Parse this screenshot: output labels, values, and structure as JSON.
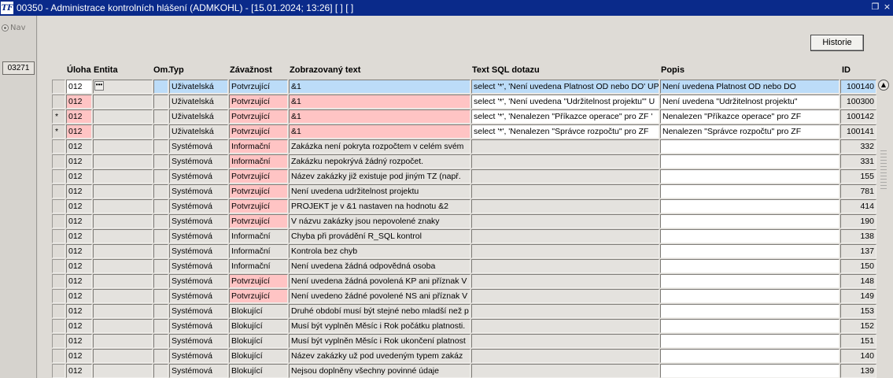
{
  "window": {
    "title": "00350 - Administrace kontrolních hlášení (ADMKOHL) - [15.01.2024; 13:26]  [ ]  [ ]",
    "logo": "TF",
    "restore_icon": "restore-icon",
    "close_icon": "close-icon"
  },
  "left": {
    "nav_label": "Nav",
    "code": "03271"
  },
  "toolbar": {
    "historie_label": "Historie"
  },
  "columns": {
    "uloha": "Úloha",
    "entita": "Entita",
    "om": "Om.",
    "typ": "Typ",
    "zavaznost": "Závažnost",
    "text": "Zobrazovaný text",
    "sql": "Text SQL dotazu",
    "popis": "Popis",
    "id": "ID"
  },
  "rows": [
    {
      "mark": "",
      "uloha": "012",
      "entita": "",
      "om": "",
      "typ": "Uživatelská",
      "zavaznost": "Potvrzující",
      "text": "&1",
      "sql": "select '*', 'Není uvedena Platnost OD nebo DO' UP",
      "popis": "Není uvedena Platnost OD nebo DO",
      "id": "100140"
    },
    {
      "mark": "",
      "uloha": "012",
      "entita": "",
      "om": "",
      "typ": "Uživatelská",
      "zavaznost": "Potvrzující",
      "text": "&1",
      "sql": "select '*', 'Není uvedena \"Udržitelnost projektu\"' U",
      "popis": "Není uvedena \"Udržitelnost projektu\"",
      "id": "100300"
    },
    {
      "mark": "*",
      "uloha": "012",
      "entita": "",
      "om": "",
      "typ": "Uživatelská",
      "zavaznost": "Potvrzující",
      "text": "&1",
      "sql": "select '*', 'Nenalezen \"Příkazce operace\" pro ZF '",
      "popis": "Nenalezen \"Příkazce operace\" pro ZF",
      "id": "100142"
    },
    {
      "mark": "*",
      "uloha": "012",
      "entita": "",
      "om": "",
      "typ": "Uživatelská",
      "zavaznost": "Potvrzující",
      "text": "&1",
      "sql": "select '*', 'Nenalezen \"Správce rozpočtu\" pro ZF",
      "popis": "Nenalezen \"Správce rozpočtu\" pro ZF",
      "id": "100141"
    },
    {
      "mark": "",
      "uloha": "012",
      "entita": "",
      "om": "",
      "typ": "Systémová",
      "zavaznost": "Informační",
      "text": "Zakázka není pokryta rozpočtem v celém svém",
      "sql": "",
      "popis": "",
      "id": "332"
    },
    {
      "mark": "",
      "uloha": "012",
      "entita": "",
      "om": "",
      "typ": "Systémová",
      "zavaznost": "Informační",
      "text": "Zakázku nepokrývá žádný rozpočet.",
      "sql": "",
      "popis": "",
      "id": "331"
    },
    {
      "mark": "",
      "uloha": "012",
      "entita": "",
      "om": "",
      "typ": "Systémová",
      "zavaznost": "Potvrzující",
      "text": "Název zakázky již existuje pod jiným TZ (např.",
      "sql": "",
      "popis": "",
      "id": "155"
    },
    {
      "mark": "",
      "uloha": "012",
      "entita": "",
      "om": "",
      "typ": "Systémová",
      "zavaznost": "Potvrzující",
      "text": "Není uvedena udržitelnost projektu",
      "sql": "",
      "popis": "",
      "id": "781"
    },
    {
      "mark": "",
      "uloha": "012",
      "entita": "",
      "om": "",
      "typ": "Systémová",
      "zavaznost": "Potvrzující",
      "text": "PROJEKT je v &1 nastaven na hodnotu &2",
      "sql": "",
      "popis": "",
      "id": "414"
    },
    {
      "mark": "",
      "uloha": "012",
      "entita": "",
      "om": "",
      "typ": "Systémová",
      "zavaznost": "Potvrzující",
      "text": "V názvu zakázky jsou nepovolené znaky",
      "sql": "",
      "popis": "",
      "id": "190"
    },
    {
      "mark": "",
      "uloha": "012",
      "entita": "",
      "om": "",
      "typ": "Systémová",
      "zavaznost": "Informační",
      "text": "Chyba při provádění R_SQL kontrol",
      "sql": "",
      "popis": "",
      "id": "138"
    },
    {
      "mark": "",
      "uloha": "012",
      "entita": "",
      "om": "",
      "typ": "Systémová",
      "zavaznost": "Informační",
      "text": "Kontrola bez chyb",
      "sql": "",
      "popis": "",
      "id": "137"
    },
    {
      "mark": "",
      "uloha": "012",
      "entita": "",
      "om": "",
      "typ": "Systémová",
      "zavaznost": "Informační",
      "text": "Není uvedena žádná odpovědná osoba",
      "sql": "",
      "popis": "",
      "id": "150"
    },
    {
      "mark": "",
      "uloha": "012",
      "entita": "",
      "om": "",
      "typ": "Systémová",
      "zavaznost": "Potvrzující",
      "text": "Není uvedena žádná povolená KP ani příznak V",
      "sql": "",
      "popis": "",
      "id": "148"
    },
    {
      "mark": "",
      "uloha": "012",
      "entita": "",
      "om": "",
      "typ": "Systémová",
      "zavaznost": "Potvrzující",
      "text": "Není uvedeno žádné povolené NS ani příznak V",
      "sql": "",
      "popis": "",
      "id": "149"
    },
    {
      "mark": "",
      "uloha": "012",
      "entita": "",
      "om": "",
      "typ": "Systémová",
      "zavaznost": "Blokující",
      "text": "Druhé období musí být stejné nebo mladší než p",
      "sql": "",
      "popis": "",
      "id": "153"
    },
    {
      "mark": "",
      "uloha": "012",
      "entita": "",
      "om": "",
      "typ": "Systémová",
      "zavaznost": "Blokující",
      "text": "Musí být vyplněn Měsíc i Rok počátku platnosti.",
      "sql": "",
      "popis": "",
      "id": "152"
    },
    {
      "mark": "",
      "uloha": "012",
      "entita": "",
      "om": "",
      "typ": "Systémová",
      "zavaznost": "Blokující",
      "text": "Musí být vyplněn Měsíc i Rok ukončení platnost",
      "sql": "",
      "popis": "",
      "id": "151"
    },
    {
      "mark": "",
      "uloha": "012",
      "entita": "",
      "om": "",
      "typ": "Systémová",
      "zavaznost": "Blokující",
      "text": "Název zakázky už pod uvedeným typem zakáz",
      "sql": "",
      "popis": "",
      "id": "140"
    },
    {
      "mark": "",
      "uloha": "012",
      "entita": "",
      "om": "",
      "typ": "Systémová",
      "zavaznost": "Blokující",
      "text": "Nejsou doplněny všechny povinné údaje",
      "sql": "",
      "popis": "",
      "id": "139"
    }
  ],
  "icons": {
    "scroll_up": "scroll-up-icon",
    "ellipsis": "ellipsis-icon"
  }
}
